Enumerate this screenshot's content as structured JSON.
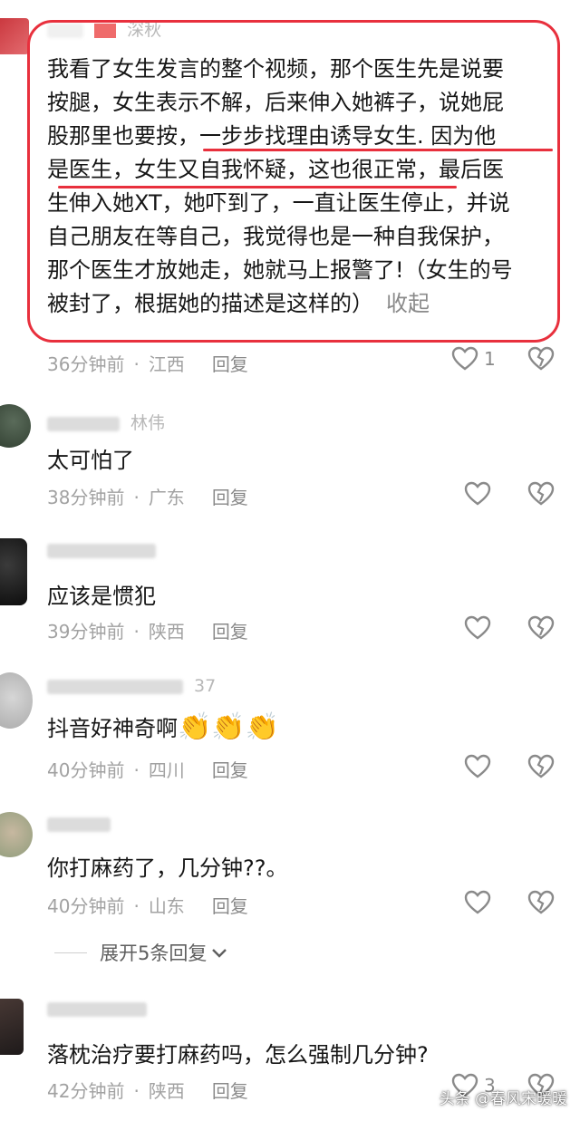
{
  "comments": [
    {
      "username": "深秋",
      "text_lines": [
        "我看了女生发言的整个视频，那个医生先是说要",
        "按腿，女生表示不解，后来伸入她裤子，说她屁",
        "股那里也要按，一步步找理由诱导女生. 因为他",
        "是医生，女生又自我怀疑，这也很正常，最后医",
        "生伸入她XT，她吓到了，一直让医生停止，并说",
        "自己朋友在等自己，我觉得也是一种自我保护，",
        "那个医生才放她走，她就马上报警了!（女生的号",
        "被封了，根据她的描述是这样的）"
      ],
      "collapse_label": "收起",
      "time": "36分钟前",
      "location": "江西",
      "reply_label": "回复",
      "likes": "1"
    },
    {
      "username": "林伟",
      "text": "太可怕了",
      "time": "38分钟前",
      "location": "广东",
      "reply_label": "回复"
    },
    {
      "username": "",
      "text": "应该是惯犯",
      "time": "39分钟前",
      "location": "陕西",
      "reply_label": "回复"
    },
    {
      "username": "37",
      "text": "抖音好神奇啊",
      "time": "40分钟前",
      "location": "四川",
      "reply_label": "回复"
    },
    {
      "username": "",
      "text": "你打麻药了，几分钟??。",
      "time": "40分钟前",
      "location": "山东",
      "reply_label": "回复",
      "expand_label": "展开5条回复"
    },
    {
      "username": "",
      "text": "落枕治疗要打麻药吗，怎么强制几分钟?",
      "time": "42分钟前",
      "location": "陕西",
      "reply_label": "回复",
      "likes": "3"
    }
  ],
  "separator": "·",
  "emoji": "👏",
  "watermark": "头条 @春风宋暖暖",
  "colors": {
    "highlight": "#e8303d",
    "meta": "#a2a2a2"
  },
  "icons": [
    "heart-icon",
    "broken-heart-icon",
    "chevron-down-icon",
    "clapping-hands-emoji"
  ]
}
